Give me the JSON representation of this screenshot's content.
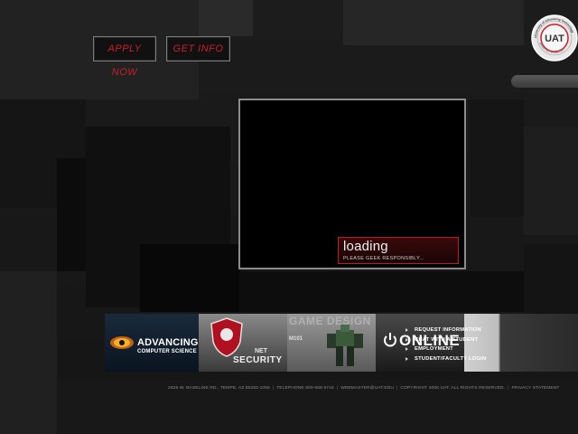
{
  "top_buttons": {
    "apply": "APPLY NOW",
    "getinfo": "GET INFO"
  },
  "logo": {
    "ring_text": "University of Advancing Technology",
    "monogram": "UAT",
    "bottom_text": "ADVANCING TECHNOLOGY"
  },
  "video": {
    "loading": "loading",
    "tagline": "PLEASE GEEK RESPONSIBLY..."
  },
  "banner": {
    "panels": [
      {
        "title": "ADVANCING",
        "subtitle": "COMPUTER SCIENCE"
      },
      {
        "title": "NET",
        "subtitle": "SECURITY"
      },
      {
        "title": "GAME DESIGN",
        "subtitle": "M101"
      },
      {
        "title": "ONLINE"
      }
    ]
  },
  "menu": [
    "REQUEST INFORMATION",
    "CHAT WITH A STUDENT",
    "EMPLOYMENT",
    "STUDENT/FACULTY LOGIN"
  ],
  "footer": {
    "address": "2625 W. BASELINE RD., TEMPE, AZ 85283-1056",
    "telephone": "TELEPHONE 800-658-5744",
    "email": "WEBMASTER@UAT.EDU",
    "copyright": "COPYRIGHT 2006 UAT. ALL RIGHTS RESERVED.",
    "privacy": "PRIVACY STATEMENT"
  },
  "colors": {
    "accent_red": "#c8202a",
    "background": "#1c1c1c"
  }
}
